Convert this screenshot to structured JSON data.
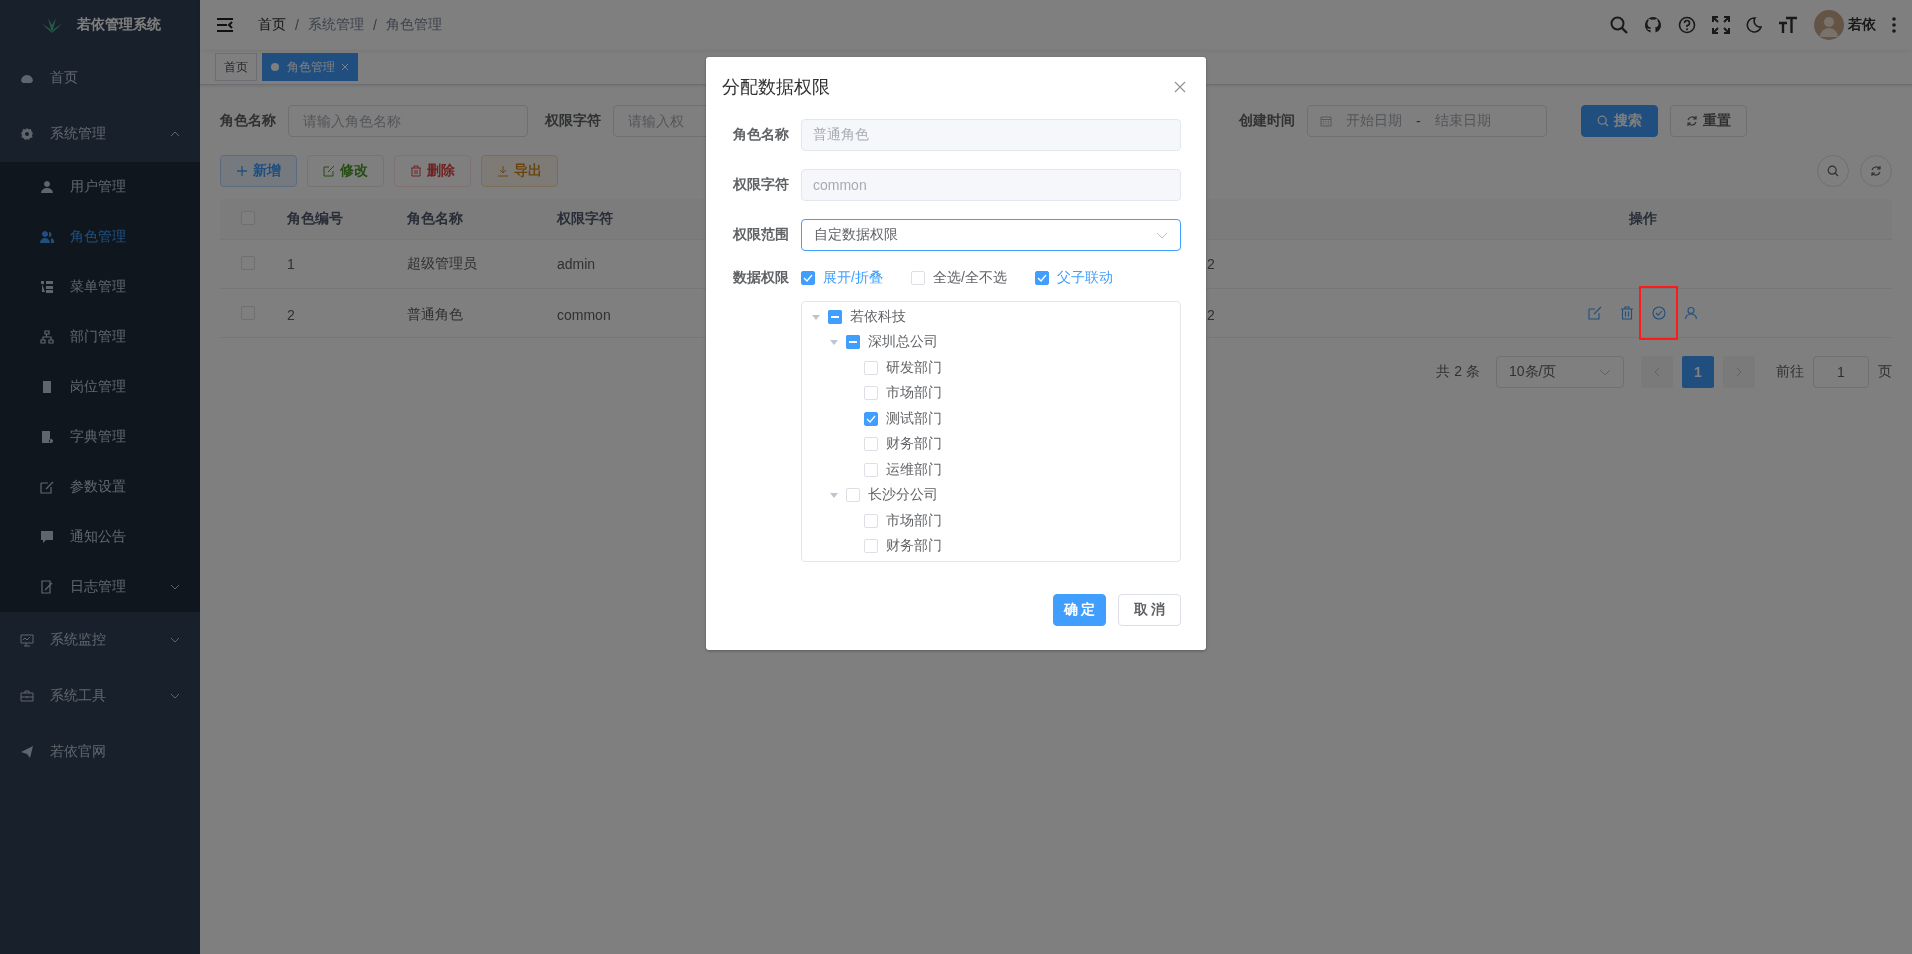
{
  "sidebar": {
    "logo_title": "若依管理系统",
    "items": [
      {
        "label": "首页",
        "selected": false
      },
      {
        "label": "系统管理",
        "selected": false,
        "expanded": true,
        "children": [
          {
            "label": "用户管理",
            "selected": false
          },
          {
            "label": "角色管理",
            "selected": true
          },
          {
            "label": "菜单管理",
            "selected": false
          },
          {
            "label": "部门管理",
            "selected": false
          },
          {
            "label": "岗位管理",
            "selected": false
          },
          {
            "label": "字典管理",
            "selected": false
          },
          {
            "label": "参数设置",
            "selected": false
          },
          {
            "label": "通知公告",
            "selected": false
          },
          {
            "label": "日志管理",
            "selected": false,
            "expanded": false
          }
        ]
      },
      {
        "label": "系统监控",
        "selected": false,
        "expanded": false
      },
      {
        "label": "系统工具",
        "selected": false,
        "expanded": false
      },
      {
        "label": "若依官网",
        "selected": false
      }
    ]
  },
  "navbar": {
    "breadcrumb": [
      "首页",
      "系统管理",
      "角色管理"
    ],
    "breadcrumb_separator": "/",
    "user_name": "若依"
  },
  "tags": [
    {
      "label": "首页",
      "selected": false
    },
    {
      "label": "角色管理",
      "selected": true
    }
  ],
  "search_form": {
    "fields": [
      {
        "label": "角色名称",
        "placeholder": "请输入角色名称"
      },
      {
        "label": "权限字符",
        "placeholder": "请输入权"
      }
    ],
    "date_range": {
      "label": "创建时间",
      "start_placeholder": "开始日期",
      "separator": "-",
      "end_placeholder": "结束日期"
    },
    "search_button": "搜索",
    "reset_button": "重置"
  },
  "toolbar": [
    {
      "label": "新增",
      "kind": "primary",
      "disabled": false
    },
    {
      "label": "修改",
      "kind": "success",
      "disabled": true
    },
    {
      "label": "删除",
      "kind": "danger",
      "disabled": true
    },
    {
      "label": "导出",
      "kind": "warning",
      "disabled": false
    }
  ],
  "table": {
    "all_selected": false,
    "columns": [
      "角色编号",
      "角色名称",
      "权限字符",
      "操作"
    ],
    "rows": [
      {
        "selected": false,
        "id": "1",
        "name": "超级管理员",
        "key": "admin",
        "column_4": "2"
      },
      {
        "selected": false,
        "id": "2",
        "name": "普通角色",
        "key": "common",
        "column_4": "2",
        "actions": [
          {
            "highlighted": false
          },
          {
            "highlighted": false
          },
          {
            "highlighted": true
          },
          {
            "highlighted": false
          }
        ]
      }
    ]
  },
  "pagination": {
    "total": "共 2 条",
    "page_size": "10条/页",
    "pages": [
      {
        "label": "1",
        "selected": true
      }
    ],
    "goto_label": "前往",
    "goto_value": "1",
    "page_suffix": "页"
  },
  "dialog": {
    "title": "分配数据权限",
    "fields": [
      {
        "label": "角色名称",
        "value": "普通角色",
        "disabled": true
      },
      {
        "label": "权限字符",
        "value": "common",
        "disabled": true
      }
    ],
    "scope": {
      "label": "权限范围",
      "value": "自定数据权限"
    },
    "data_scope": {
      "label": "数据权限",
      "options": [
        {
          "label": "展开/折叠",
          "checked": true
        },
        {
          "label": "全选/全不选",
          "checked": false
        },
        {
          "label": "父子联动",
          "checked": true
        }
      ]
    },
    "tree": [
      {
        "label": "若依科技",
        "checked": true,
        "indeterminate": true,
        "expanded": true,
        "children": [
          {
            "label": "深圳总公司",
            "checked": true,
            "indeterminate": true,
            "expanded": true,
            "children": [
              {
                "label": "研发部门",
                "checked": false,
                "indeterminate": false
              },
              {
                "label": "市场部门",
                "checked": false,
                "indeterminate": false
              },
              {
                "label": "测试部门",
                "checked": true,
                "indeterminate": false
              },
              {
                "label": "财务部门",
                "checked": false,
                "indeterminate": false
              },
              {
                "label": "运维部门",
                "checked": false,
                "indeterminate": false
              }
            ]
          },
          {
            "label": "长沙分公司",
            "checked": false,
            "indeterminate": false,
            "expanded": true,
            "children": [
              {
                "label": "市场部门",
                "checked": false,
                "indeterminate": false
              },
              {
                "label": "财务部门",
                "checked": false,
                "indeterminate": false
              }
            ]
          }
        ]
      }
    ],
    "confirm_button": "确 定",
    "cancel_button": "取 消"
  }
}
